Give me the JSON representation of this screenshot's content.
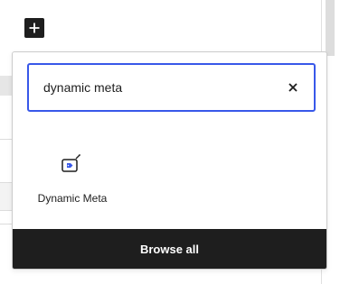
{
  "inserter": {
    "add_icon": "plus-icon",
    "search": {
      "value": "dynamic meta",
      "placeholder": "Search",
      "clear_icon": "close-icon"
    },
    "results": [
      {
        "label": "Dynamic Meta",
        "icon": "dynamic-meta-tag-icon"
      }
    ],
    "browse_all_label": "Browse all"
  },
  "colors": {
    "accent": "#3858e9",
    "dark": "#1e1e1e",
    "border": "#cccccc"
  }
}
